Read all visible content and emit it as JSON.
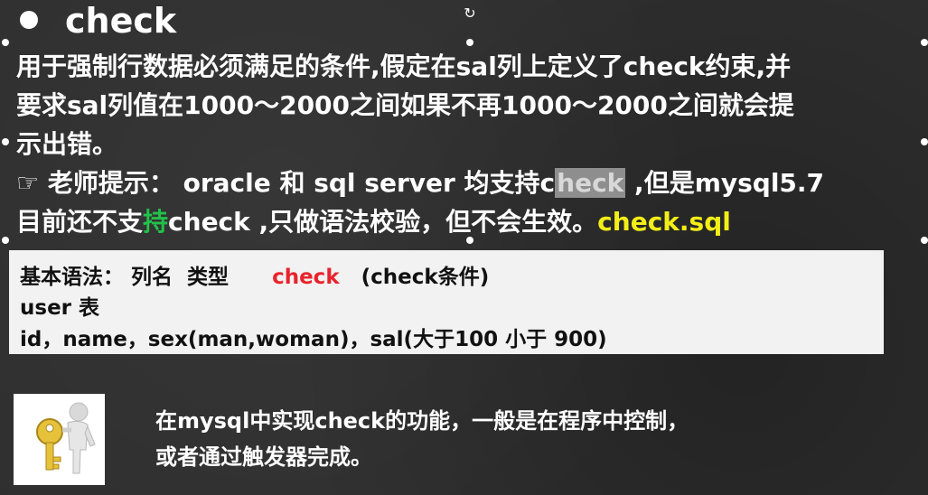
{
  "title": "check",
  "body": {
    "line1": "用于强制行数据必须满足的条件,假定在sal列上定义了check约束,并",
    "line2": "要求sal列值在1000～2000之间如果不再1000～2000之间就会提",
    "line3": "示出错。",
    "line4_icon": "☞",
    "line4_a": " 老师提示： oracle 和 sql server 均支持c",
    "line4_hl": "heck",
    "line4_b": " ,但是mysql5.7",
    "line5_a": "目前还不支",
    "line5_green": "持",
    "line5_b": "check ,只做语法校验，但不会生效。",
    "line5_file": "check.sql"
  },
  "syntax": {
    "line1_a": "基本语法： 列名  类型",
    "line1_kw": "check",
    "line1_b": "(check条件)",
    "line2": "user 表",
    "line3": "id，name，sex(man,woman)，sal(大于100 小于 900)"
  },
  "footer": {
    "line1": "在mysql中实现check的功能，一般是在程序中控制，",
    "line2": "或者通过触发器完成。"
  },
  "colors": {
    "background": "#2f2f2f",
    "highlight_yellow": "#f2ee17",
    "keyword_red": "#e8232b",
    "accent_green": "#22c04a"
  },
  "icons": {
    "title_bullet": "bullet-icon",
    "rotate": "rotate-handle-icon",
    "hand": "pointing-hand-icon",
    "figure": "person-with-key-icon"
  }
}
